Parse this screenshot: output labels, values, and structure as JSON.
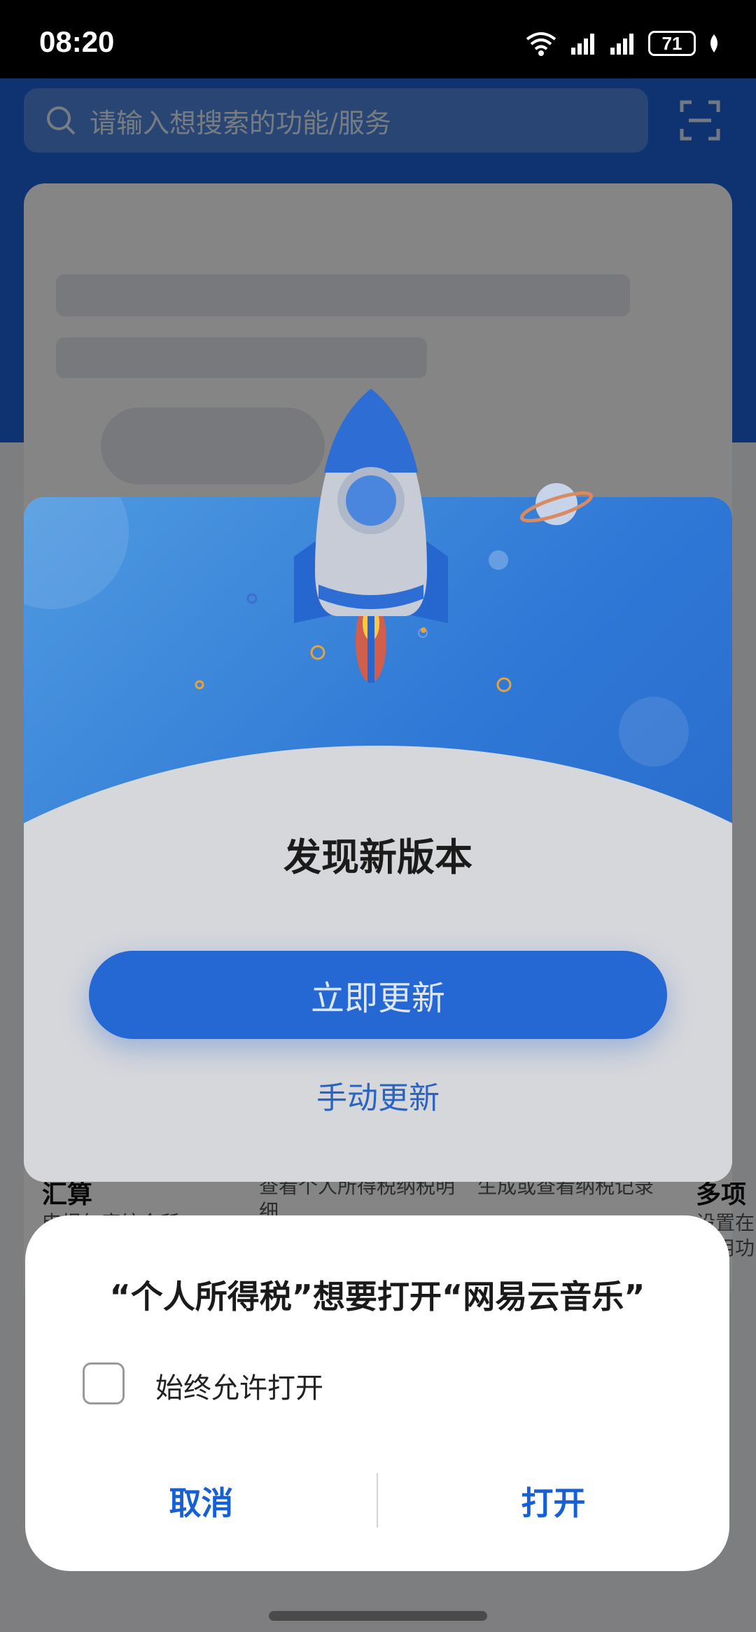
{
  "status_bar": {
    "time": "08:20",
    "battery": "71"
  },
  "background_app": {
    "search_placeholder": "请输入想搜索的功能/服务",
    "services": [
      {
        "title": "汇算",
        "desc": "申报年度综合所"
      },
      {
        "title": "",
        "desc": "查看个人所得税纳税明细"
      },
      {
        "title": "",
        "desc": "生成或查看纳税记录"
      },
      {
        "title": "多项",
        "desc": "设置在常用功"
      }
    ]
  },
  "update_dialog": {
    "title": "发现新版本",
    "update_now": "立即更新",
    "manual_update": "手动更新"
  },
  "system_dialog": {
    "title": "“个人所得税”想要打开“网易云音乐”",
    "always_allow": "始终允许打开",
    "cancel": "取消",
    "open": "打开",
    "accent_color": "#1560d6"
  }
}
